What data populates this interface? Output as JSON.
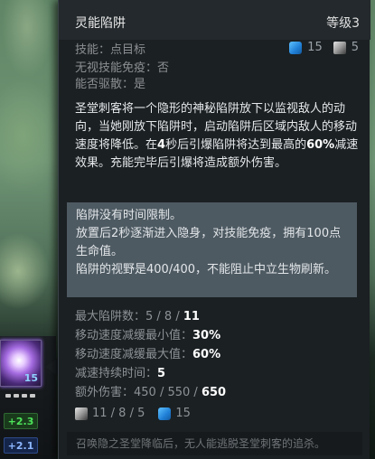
{
  "hud": {
    "skill_cooldown": "15",
    "stat_green": "+2.3",
    "stat_blue": "+2.1"
  },
  "tooltip": {
    "title": "灵能陷阱",
    "level": "等级3",
    "meta": {
      "targeting": "技能：点目标",
      "spell_immunity": "无视技能免疫：否",
      "dispellable": "能否驱散：是",
      "mana_cost": "15",
      "cooldown": "5"
    },
    "description": [
      {
        "text": "圣堂刺客将一个隐形的神秘陷阱放下以监视敌人的动向，当她刚放下陷阱时，启动陷阱后区域内敌人的移动速度将降低。在",
        "bold": false
      },
      {
        "text": "4",
        "bold": true
      },
      {
        "text": "秒后引爆陷阱将达到最高的",
        "bold": false
      },
      {
        "text": "60%",
        "bold": true
      },
      {
        "text": "减速效果。充能完毕后引爆将造成额外伤害。",
        "bold": false
      }
    ],
    "notes": [
      "陷阱没有时间限制。",
      "放置后2秒逐渐进入隐身，对技能免疫，拥有100点生命值。",
      "陷阱的视野是400/400，不能阻止中立生物刷新。"
    ],
    "stats": [
      {
        "label": "最大陷阱数：",
        "values": "5 / 8 / ",
        "current": "11"
      },
      {
        "label": "移动速度减缓最小值：",
        "values": "",
        "current": "30%"
      },
      {
        "label": "移动速度减缓最大值：",
        "values": "",
        "current": "60%"
      },
      {
        "label": "减速持续时间：",
        "values": "",
        "current": "5"
      },
      {
        "label": "额外伤害：",
        "values": "450 / 550 / ",
        "current": "650"
      }
    ],
    "cost_line": {
      "cooldown_values": "11 / 8 / ",
      "cooldown_current": "5",
      "mana": "15"
    },
    "lore": "召唤隐之圣堂降临后，无人能逃脱圣堂刺客的追杀。"
  },
  "colors": {
    "panel": "#1b2023",
    "notes_bg": "#4e5a62",
    "mana": "#1f7fd6",
    "green_stat": "#4de35a",
    "blue_stat": "#8db6ff"
  }
}
